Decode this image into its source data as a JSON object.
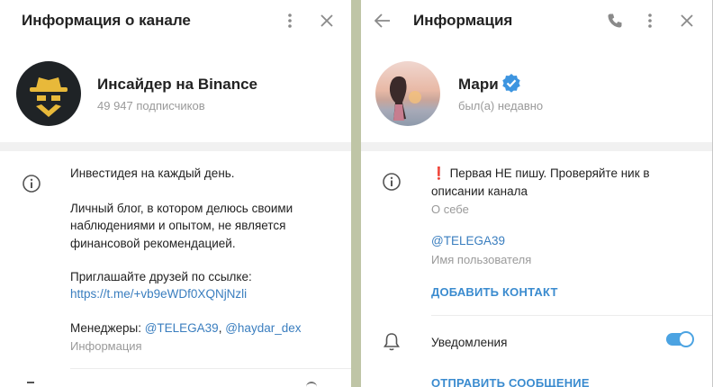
{
  "left": {
    "header_title": "Информация о канале",
    "channel_name": "Инсайдер на Binance",
    "subscribers": "49 947 подписчиков",
    "description": {
      "line1": "Инвестидея на каждый день.",
      "line2": "Личный блог, в котором делюсь своими",
      "line3": "наблюдениями и опытом, не является",
      "line4": "финансовой рекомендацией.",
      "line5": "Приглашайте друзей по ссылке:",
      "invite_link": "https://t.me/+vb9eWDf0XQNjNzli",
      "managers_prefix": "Менеджеры: ",
      "manager1": "@TELEGA39",
      "managers_sep": ", ",
      "manager2": "@haydar_dex"
    },
    "caption_info": "Информация"
  },
  "right": {
    "header_title": "Информация",
    "user_name": "Мари",
    "status": "был(а) недавно",
    "bio_emoji": "❗",
    "bio_line1": "Первая НЕ пишу. Проверяйте ник в",
    "bio_line2": "описании канала",
    "caption_bio": "О себе",
    "username": "@TELEGA39",
    "caption_username": "Имя пользователя",
    "add_contact": "ДОБАВИТЬ КОНТАКТ",
    "notifications_label": "Уведомления",
    "notifications_on": true,
    "send_message": "ОТПРАВИТЬ СООБЩЕНИЕ"
  },
  "colors": {
    "accent": "#3a8bcf",
    "verified": "#3d95e0",
    "toggle": "#4ba3e2"
  },
  "icons": [
    "back-arrow-icon",
    "phone-icon",
    "more-vertical-icon",
    "close-icon",
    "info-icon",
    "bell-icon",
    "verified-badge-icon"
  ]
}
